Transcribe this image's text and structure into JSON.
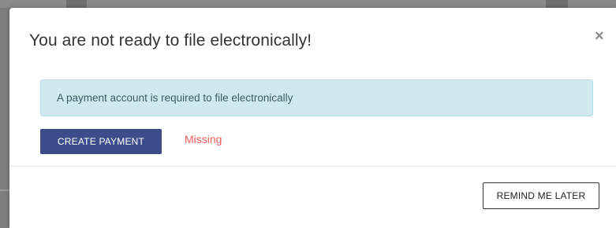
{
  "dialog": {
    "title": "You are not ready to file electronically!",
    "close_symbol": "×",
    "close_icon": "close-icon"
  },
  "alert": {
    "message": "A payment account is required to file electronically"
  },
  "actions": {
    "create_payment_label": "CREATE PAYMENT",
    "status_text": "Missing",
    "remind_later_label": "REMIND ME LATER"
  },
  "colors": {
    "primary_button": "#3d4d8c",
    "alert_background": "#d0e9ef",
    "status_missing": "#f25c5c"
  }
}
